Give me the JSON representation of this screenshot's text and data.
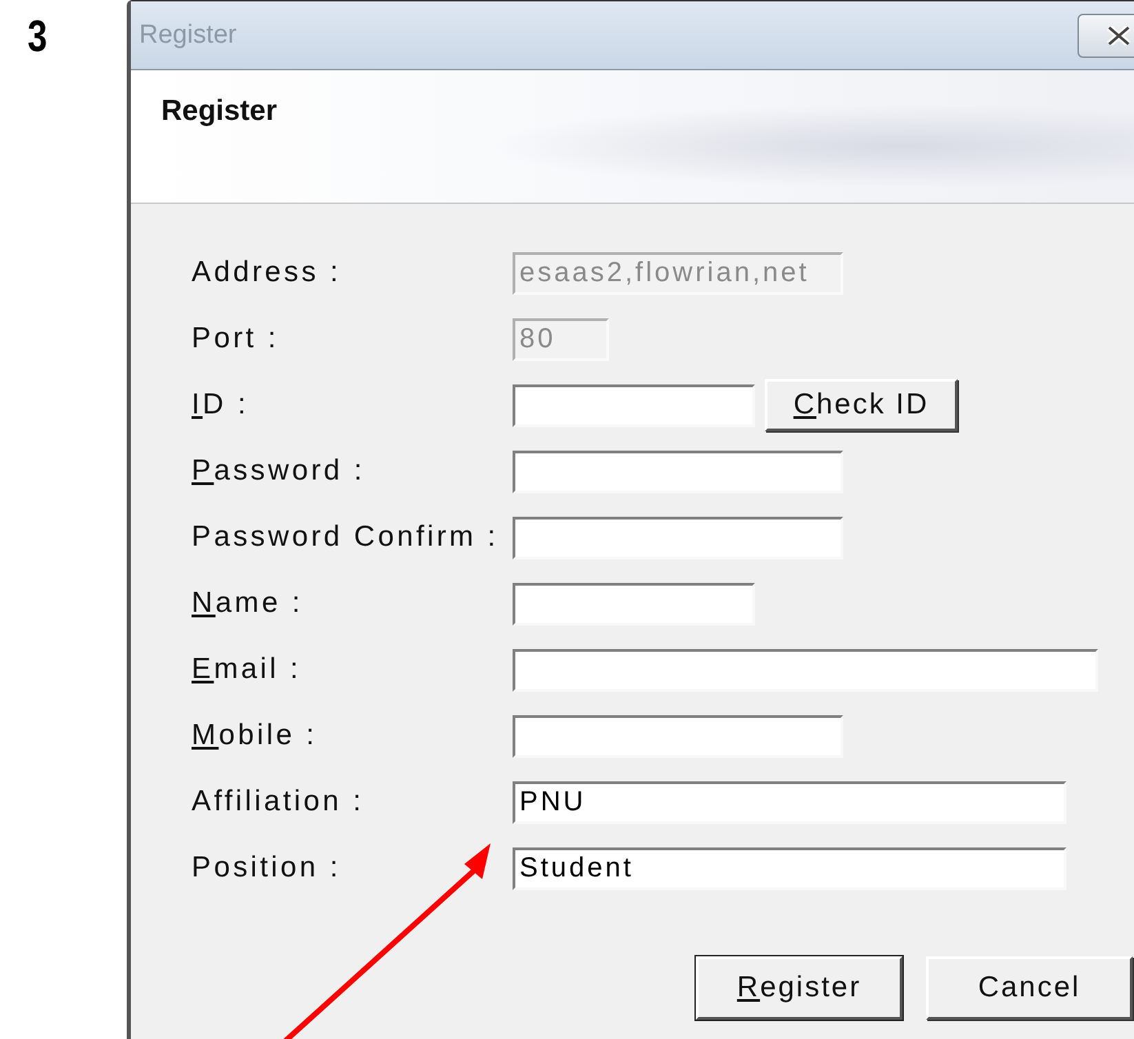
{
  "step": "3",
  "window": {
    "title": "Register",
    "heading": "Register"
  },
  "fields": [
    {
      "label": "Address :",
      "mnemonic": false,
      "kind": "medium",
      "value": "esaas2,flowrian,net",
      "disabled": true
    },
    {
      "label": "Port :",
      "mnemonic": false,
      "kind": "tiny",
      "value": "80",
      "disabled": true
    },
    {
      "label": "ID :",
      "mnemonic": true,
      "kind": "short",
      "disabled": false,
      "button": {
        "label": "Check ID",
        "mnemonic": true
      }
    },
    {
      "label": "Password :",
      "mnemonic": true,
      "kind": "medium",
      "disabled": false
    },
    {
      "label": "Password Confirm :",
      "mnemonic": false,
      "kind": "medium",
      "disabled": false
    },
    {
      "label": "Name :",
      "mnemonic": true,
      "kind": "short",
      "disabled": false
    },
    {
      "label": "Email :",
      "mnemonic": true,
      "kind": "full",
      "disabled": false
    },
    {
      "label": "Mobile :",
      "mnemonic": true,
      "kind": "medium",
      "disabled": false
    },
    {
      "label": "Affiliation :",
      "mnemonic": false,
      "kind": "wide",
      "value": "PNU",
      "disabled": false
    },
    {
      "label": "Position :",
      "mnemonic": false,
      "kind": "wide",
      "value": "Student",
      "disabled": false
    }
  ],
  "buttons": [
    {
      "label": "Register",
      "mnemonic": true
    },
    {
      "label": "Cancel",
      "mnemonic": false
    }
  ]
}
